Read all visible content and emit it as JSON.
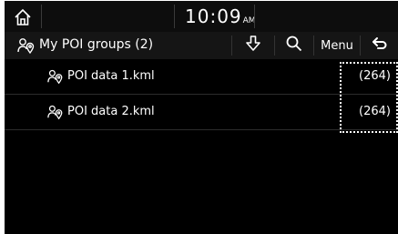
{
  "status_bar": {
    "time": "10:09",
    "ampm": "AM"
  },
  "title_bar": {
    "title": "My POI groups (2)",
    "menu_label": "Menu",
    "icons": [
      "home-icon",
      "poi-group-icon",
      "download-icon",
      "search-icon",
      "back-icon"
    ]
  },
  "list": {
    "items": [
      {
        "label": "POI data 1.kml",
        "count": "(264)",
        "icon": "poi-file-icon"
      },
      {
        "label": "POI data 2.kml",
        "count": "(264)",
        "icon": "poi-file-icon"
      }
    ]
  },
  "colors": {
    "background": "#000000",
    "text": "#ffffff",
    "divider": "#2c2c2c"
  }
}
